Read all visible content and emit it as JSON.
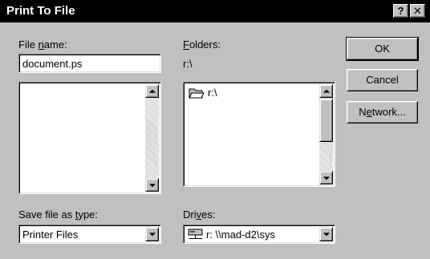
{
  "window": {
    "title": "Print To File"
  },
  "caption_buttons": {
    "help": "?",
    "close": "✕"
  },
  "file_name": {
    "label": "File name:",
    "value": "document.ps",
    "files": []
  },
  "folders": {
    "label": "Folders:",
    "current_path": "r:\\",
    "items": [
      "r:\\"
    ]
  },
  "save_as_type": {
    "label": "Save file as type:",
    "selected": "Printer Files"
  },
  "drives": {
    "label": "Drives:",
    "selected": "r: \\\\mad-d2\\sys"
  },
  "buttons": {
    "ok": "OK",
    "cancel": "Cancel",
    "network": "Network..."
  },
  "icons": {
    "folder": "open-folder-icon",
    "drive": "network-drive-icon"
  }
}
